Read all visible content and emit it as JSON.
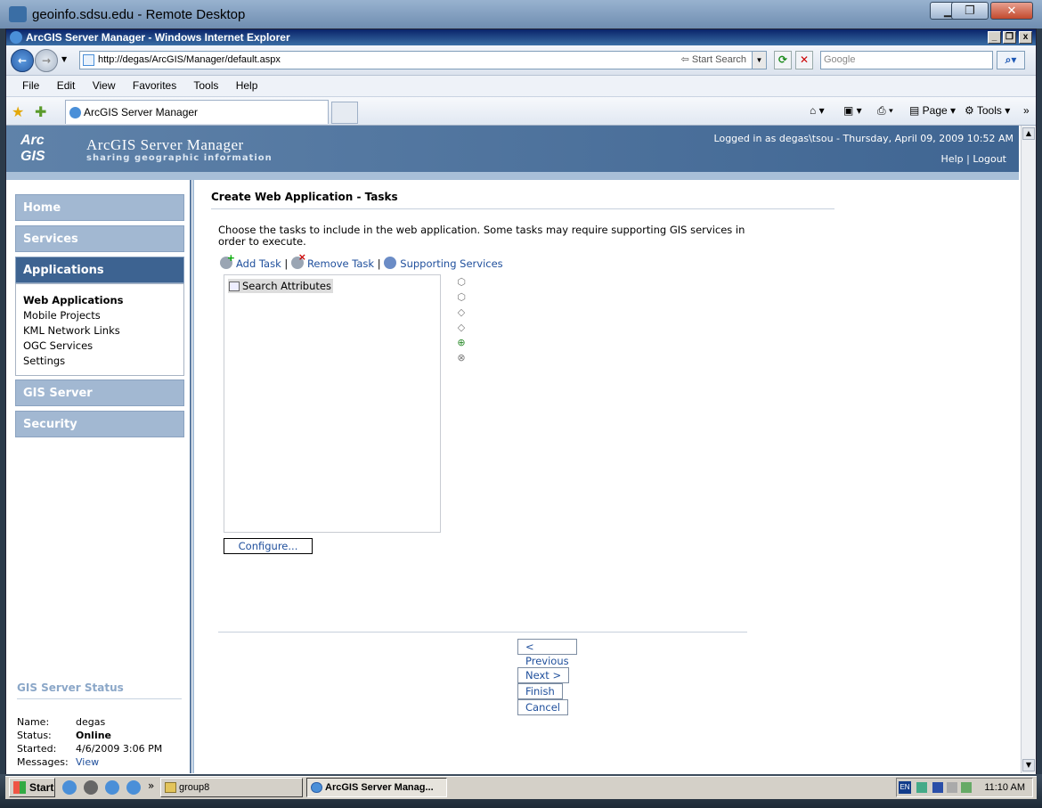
{
  "rd": {
    "title": "geoinfo.sdsu.edu - Remote Desktop",
    "min": "▁",
    "max": "❐",
    "close": "✕"
  },
  "ie": {
    "title": "ArcGIS Server Manager - Windows Internet Explorer",
    "url": "http://degas/ArcGIS/Manager/default.aspx",
    "search_label": "Start Search",
    "search_placeholder": "Google",
    "tab_title": "ArcGIS Server Manager"
  },
  "menu": [
    "File",
    "Edit",
    "View",
    "Favorites",
    "Tools",
    "Help"
  ],
  "cmdbar": {
    "page": "Page",
    "tools": "Tools"
  },
  "banner": {
    "logo": "Arc GIS",
    "title": "ArcGIS Server Manager",
    "subtitle": "sharing geographic information",
    "logged": "Logged in as degas\\tsou - Thursday, April 09, 2009 10:52 AM",
    "help": "Help",
    "logout": "Logout"
  },
  "nav": {
    "home": "Home",
    "services": "Services",
    "applications": "Applications",
    "gis_server": "GIS Server",
    "security": "Security"
  },
  "sub": [
    "Web Applications",
    "Mobile Projects",
    "KML Network Links",
    "OGC Services",
    "Settings"
  ],
  "status": {
    "heading": "GIS Server Status",
    "name_k": "Name:",
    "name_v": "degas",
    "status_k": "Status:",
    "status_v": "Online",
    "started_k": "Started:",
    "started_v": "4/6/2009 3:06 PM",
    "messages_k": "Messages:",
    "messages_v": "View"
  },
  "main": {
    "title": "Create Web Application - Tasks",
    "desc": "Choose the tasks to include in the web application. Some tasks may require supporting GIS services in order to execute.",
    "add": "Add Task",
    "remove": "Remove Task",
    "supporting": "Supporting Services",
    "task": "Search Attributes",
    "configure": "Configure...",
    "previous": "< Previous",
    "next": "Next >",
    "finish": "Finish",
    "cancel": "Cancel"
  },
  "taskbar": {
    "start": "Start",
    "group": "group8",
    "app": "ArcGIS Server Manag...",
    "lang": "EN",
    "clock": "11:10 AM"
  }
}
